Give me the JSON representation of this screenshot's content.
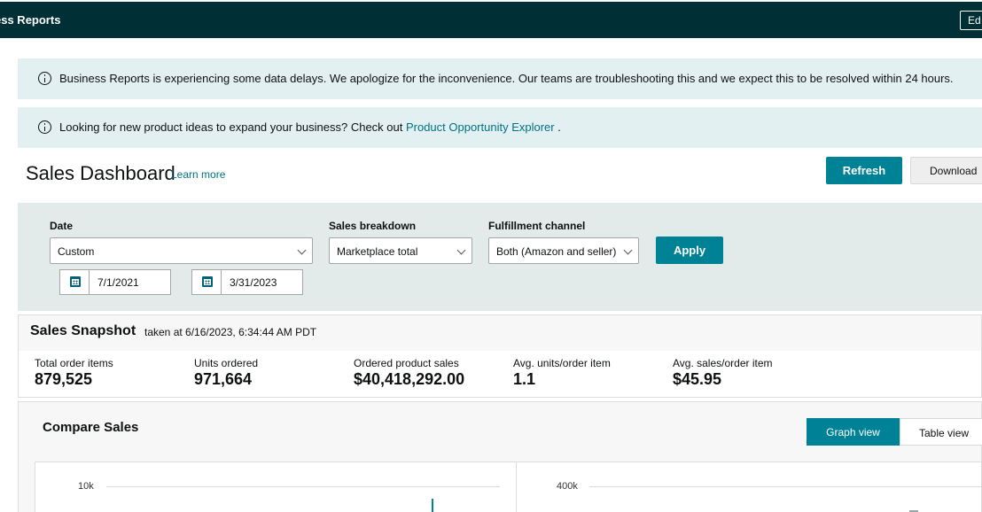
{
  "header": {
    "title": "ess Reports",
    "right_button_label": "Ed"
  },
  "alerts": [
    {
      "text": "Business Reports is experiencing some data delays. We apologize for the inconvenience. Our teams are troubleshooting this and we expect this to be resolved within 24 hours."
    },
    {
      "text": "Looking for new product ideas to expand your business? Check out ",
      "link": "Product Opportunity Explorer",
      "suffix": " ."
    }
  ],
  "page": {
    "title": "Sales Dashboard",
    "learn_more": "Learn more",
    "refresh_label": "Refresh",
    "download_label": "Download"
  },
  "filters": {
    "date_label": "Date",
    "date_value": "Custom",
    "start_date": "7/1/2021",
    "end_date": "3/31/2023",
    "breakdown_label": "Sales breakdown",
    "breakdown_value": "Marketplace total",
    "channel_label": "Fulfillment channel",
    "channel_value": "Both (Amazon and seller)",
    "apply_label": "Apply"
  },
  "snapshot": {
    "title": "Sales Snapshot",
    "taken": "taken at 6/16/2023, 6:34:44 AM PDT",
    "metrics": [
      {
        "label": "Total order items",
        "value": "879,525"
      },
      {
        "label": "Units ordered",
        "value": "971,664"
      },
      {
        "label": "Ordered product sales",
        "value": "$40,418,292.00"
      },
      {
        "label": "Avg. units/order item",
        "value": "1.1"
      },
      {
        "label": "Avg. sales/order item",
        "value": "$45.95"
      }
    ]
  },
  "compare": {
    "title": "Compare Sales",
    "graph_view_label": "Graph view",
    "table_view_label": "Table view",
    "left_chart_top_tick": "10k",
    "right_chart_top_tick": "400k"
  },
  "colors": {
    "topbar": "#002f36",
    "accent": "#008296",
    "alert_bg": "#e3f0f1",
    "link": "#007185"
  }
}
